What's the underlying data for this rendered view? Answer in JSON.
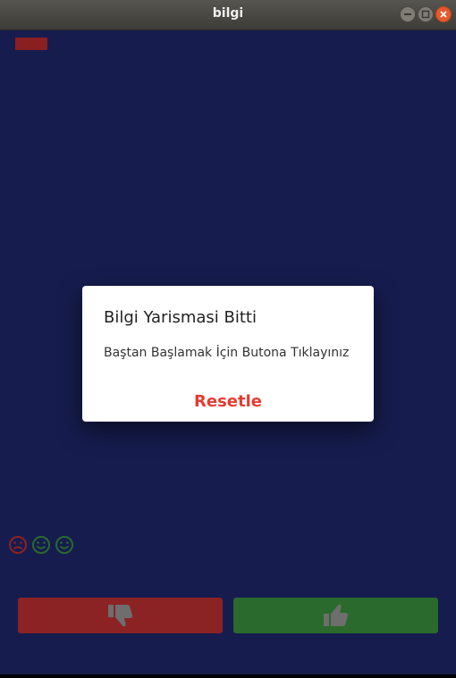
{
  "window": {
    "title": "bilgi"
  },
  "dialog": {
    "title": "Bilgi Yarismasi Bitti",
    "message": "Baştan Başlamak İçin Butona Tıklayınız",
    "action_label": "Resetle"
  },
  "scoreboard": {
    "icons": [
      "sad-face-icon",
      "smile-face-icon",
      "smile-face-icon"
    ]
  },
  "buttons": {
    "wrong_icon": "thumbs-down-icon",
    "right_icon": "thumbs-up-icon"
  },
  "colors": {
    "background": "#161c4e",
    "wrong": "#8b2224",
    "right": "#2a6a2d",
    "accent": "#e53c33"
  }
}
